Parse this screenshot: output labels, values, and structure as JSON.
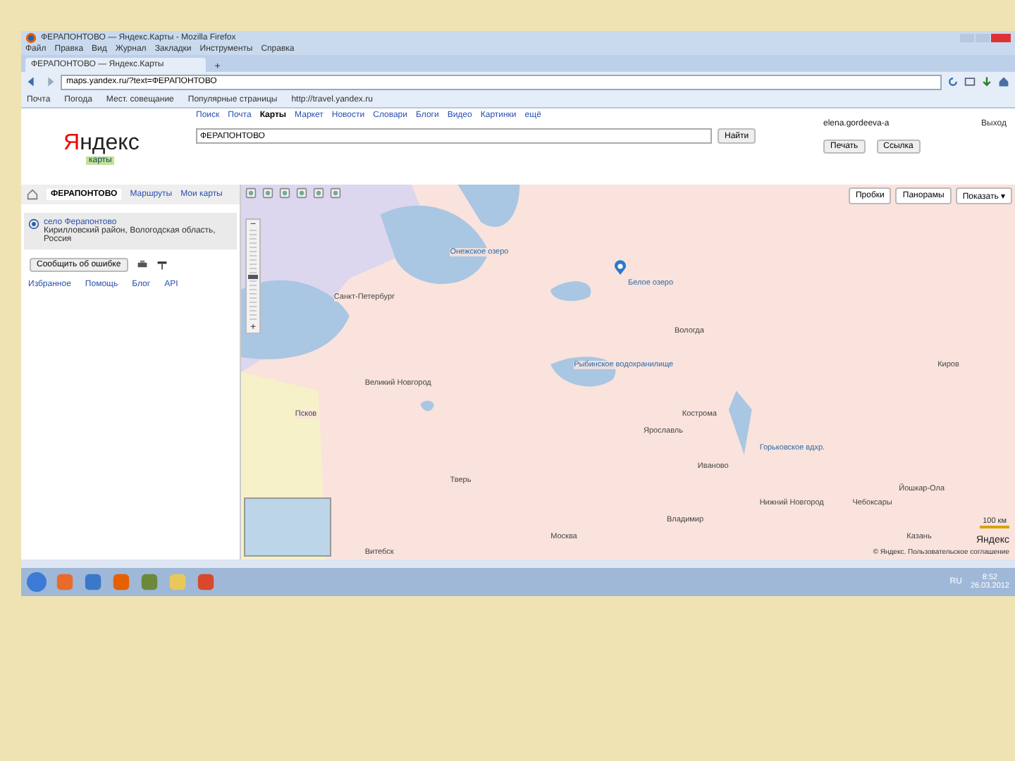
{
  "window": {
    "title": "ФЕРАПОНТОВО — Яндекс.Карты - Mozilla Firefox"
  },
  "menu": [
    "Файл",
    "Правка",
    "Вид",
    "Журнал",
    "Закладки",
    "Инструменты",
    "Справка"
  ],
  "tabs": [
    {
      "label": "ФЕРАПОНТОВО — Яндекс.Карты",
      "selected": true
    }
  ],
  "new_tab": "+",
  "address": {
    "value": "maps.yandex.ru/?text=ФЕРАПОНТОВО"
  },
  "bookmarks": [
    "Почта",
    "Погода",
    "Мест. совещание",
    "Популярные страницы",
    "http://travel.yandex.ru"
  ],
  "services": [
    {
      "label": "Поиск",
      "selected": false
    },
    {
      "label": "Почта",
      "selected": false
    },
    {
      "label": "Карты",
      "selected": true
    },
    {
      "label": "Маркет",
      "selected": false
    },
    {
      "label": "Новости",
      "selected": false
    },
    {
      "label": "Словари",
      "selected": false
    },
    {
      "label": "Блоги",
      "selected": false
    },
    {
      "label": "Видео",
      "selected": false
    },
    {
      "label": "Картинки",
      "selected": false
    },
    {
      "label": "ещё",
      "selected": false
    }
  ],
  "logo": {
    "name": "Яндекс",
    "sub": "карты"
  },
  "search": {
    "value": "ФЕРАПОНТОВО",
    "button": "Найти"
  },
  "user": {
    "login": "elena.gordeeva-a",
    "logout": "Выход"
  },
  "actions": [
    "Печать",
    "Ссылка"
  ],
  "panel_tabs": [
    {
      "label": "ФЕРАПОНТОВО",
      "selected": true
    },
    {
      "label": "Маршруты",
      "selected": false
    },
    {
      "label": "Мои карты",
      "selected": false
    }
  ],
  "result": {
    "title": "село Ферапонтово",
    "address": "Кирилловский район, Вологодская область, Россия"
  },
  "report": "Сообщить об ошибке",
  "footer_links": [
    "Избранное",
    "Помощь",
    "Блог",
    "API"
  ],
  "map_buttons": [
    "Пробки",
    "Панорамы",
    "Показать ▾"
  ],
  "zoom": {
    "out": "−",
    "in": "+",
    "level": 0.5
  },
  "places": [
    {
      "name": "Онежское озеро",
      "kind": "water"
    },
    {
      "name": "Белое озеро",
      "kind": "water"
    },
    {
      "name": "Санкт-Петербург",
      "kind": "city"
    },
    {
      "name": "Вологда",
      "kind": "city"
    },
    {
      "name": "Рыбинское водохранилище",
      "kind": "water"
    },
    {
      "name": "Киров",
      "kind": "city"
    },
    {
      "name": "Великий Новгород",
      "kind": "city"
    },
    {
      "name": "Псков",
      "kind": "city"
    },
    {
      "name": "Кострома",
      "kind": "city"
    },
    {
      "name": "Ярославль",
      "kind": "city"
    },
    {
      "name": "Горьковское вдхр.",
      "kind": "water"
    },
    {
      "name": "Иваново",
      "kind": "city"
    },
    {
      "name": "Тверь",
      "kind": "city"
    },
    {
      "name": "Йошкар-Ола",
      "kind": "city"
    },
    {
      "name": "Нижний Новгород",
      "kind": "city"
    },
    {
      "name": "Чебоксары",
      "kind": "city"
    },
    {
      "name": "Владимир",
      "kind": "city"
    },
    {
      "name": "Москва",
      "kind": "city"
    },
    {
      "name": "Казань",
      "kind": "city"
    },
    {
      "name": "Витебск",
      "kind": "city"
    }
  ],
  "scale": "100 км",
  "map_logo": "Яндекс",
  "copyright": "© Яндекс. Пользовательское соглашение",
  "taskbar": {
    "lang": "RU",
    "time": "8:52",
    "date": "26.03.2012"
  }
}
